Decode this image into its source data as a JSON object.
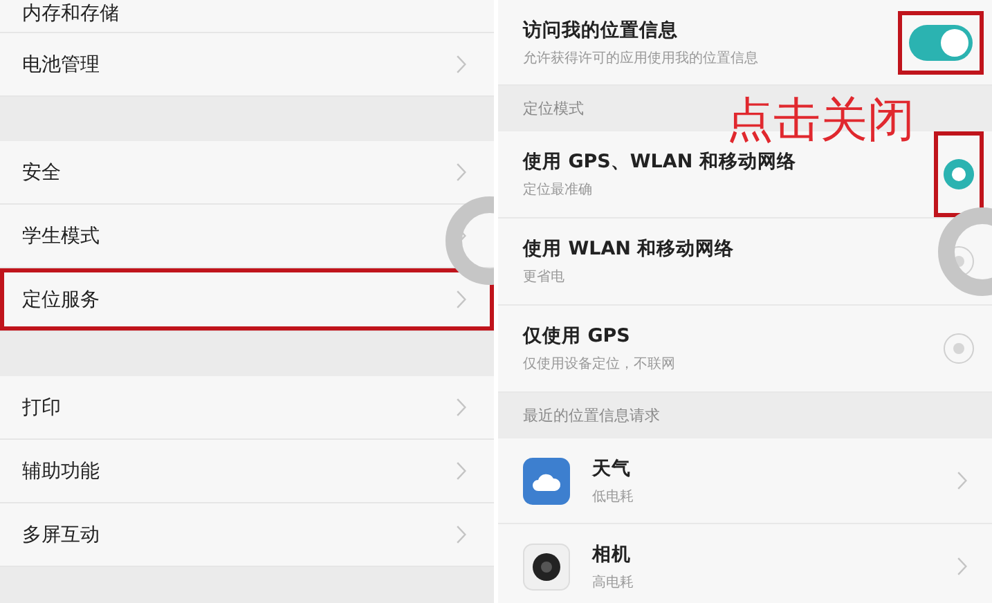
{
  "left_panel": {
    "groups": [
      {
        "items": [
          {
            "label": "内存和存储",
            "highlighted": false
          },
          {
            "label": "电池管理",
            "highlighted": false
          }
        ]
      },
      {
        "items": [
          {
            "label": "安全",
            "highlighted": false
          },
          {
            "label": "学生模式",
            "highlighted": false
          },
          {
            "label": "定位服务",
            "highlighted": true
          }
        ]
      },
      {
        "items": [
          {
            "label": "打印",
            "highlighted": false
          },
          {
            "label": "辅助功能",
            "highlighted": false
          },
          {
            "label": "多屏互动",
            "highlighted": false
          }
        ]
      }
    ]
  },
  "right_panel": {
    "location_access": {
      "title": "访问我的位置信息",
      "subtitle": "允许获得许可的应用使用我的位置信息",
      "on": true,
      "highlighted": true
    },
    "mode_header": "定位模式",
    "modes": [
      {
        "title": "使用 GPS、WLAN 和移动网络",
        "subtitle": "定位最准确",
        "selected": true,
        "highlighted": true
      },
      {
        "title": "使用 WLAN 和移动网络",
        "subtitle": "更省电",
        "selected": false,
        "highlighted": false
      },
      {
        "title": "仅使用 GPS",
        "subtitle": "仅使用设备定位，不联网",
        "selected": false,
        "highlighted": false
      }
    ],
    "recent_header": "最近的位置信息请求",
    "apps": [
      {
        "kind": "weather",
        "name": "天气",
        "usage": "低电耗"
      },
      {
        "kind": "camera",
        "name": "相机",
        "usage": "高电耗"
      }
    ]
  },
  "annotation": "点击关闭"
}
